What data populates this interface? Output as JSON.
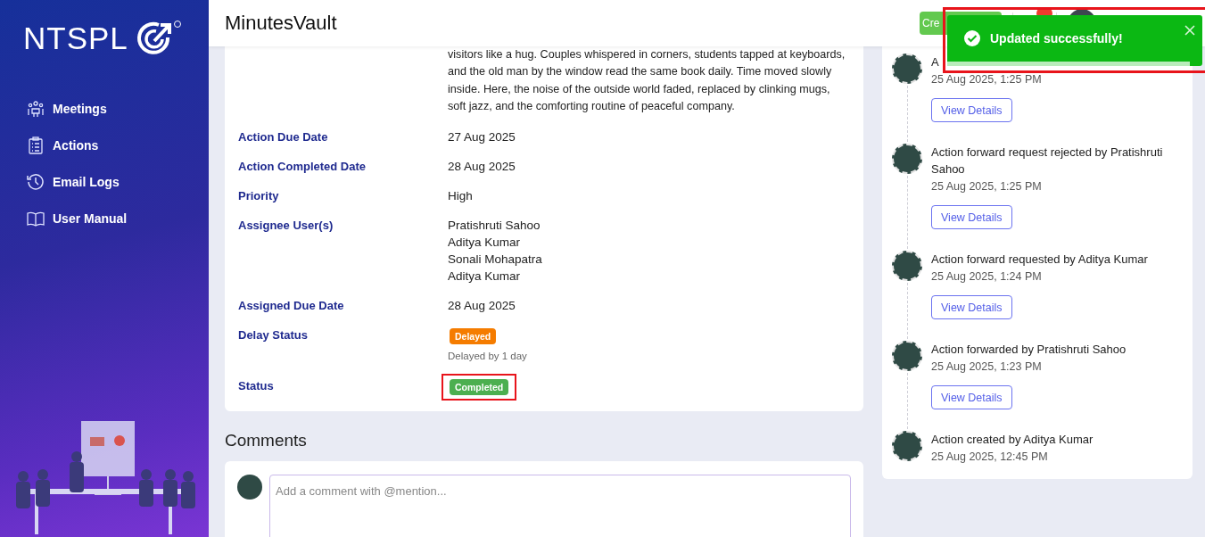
{
  "sidebar": {
    "logo": "NTSPL",
    "items": [
      {
        "label": "Meetings"
      },
      {
        "label": "Actions"
      },
      {
        "label": "Email Logs"
      },
      {
        "label": "User Manual"
      }
    ]
  },
  "header": {
    "title": "MinutesVault",
    "create_button": "Cre"
  },
  "details": {
    "description": "visitors like a hug. Couples whispered in corners, students tapped at keyboards,\nand the old man by the window read the same book daily. Time moved slowly\ninside. Here, the noise of the outside world faded, replaced by clinking mugs,\nsoft jazz, and the comforting routine of peaceful company.",
    "fields": [
      {
        "kind": "text",
        "label": "Action Due Date",
        "value": "27 Aug 2025"
      },
      {
        "kind": "text",
        "label": "Action Completed Date",
        "value": "28 Aug 2025"
      },
      {
        "kind": "text",
        "label": "Priority",
        "value": "High"
      },
      {
        "kind": "list",
        "label": "Assignee User(s)",
        "values": [
          "Pratishruti Sahoo",
          "Aditya Kumar",
          "Sonali Mohapatra",
          "Aditya Kumar"
        ]
      },
      {
        "kind": "text",
        "label": "Assigned Due Date",
        "value": "28 Aug 2025"
      },
      {
        "kind": "badge",
        "label": "Delay Status",
        "badge": "Delayed",
        "color": "#f57c00",
        "note": "Delayed by 1 day",
        "highlighted": false
      },
      {
        "kind": "badge",
        "label": "Status",
        "badge": "Completed",
        "color": "#4caf50",
        "highlighted": true
      }
    ]
  },
  "comments": {
    "title": "Comments",
    "placeholder": "Add a comment with @mention..."
  },
  "timeline": [
    {
      "title": "A",
      "time": "25 Aug 2025, 1:25 PM",
      "button": "View Details"
    },
    {
      "title": "Action forward request rejected by Pratishruti Sahoo",
      "time": "25 Aug 2025, 1:25 PM",
      "button": "View Details"
    },
    {
      "title": "Action forward requested by Aditya Kumar",
      "time": "25 Aug 2025, 1:24 PM",
      "button": "View Details"
    },
    {
      "title": "Action forwarded by Pratishruti Sahoo",
      "time": "25 Aug 2025, 1:23 PM",
      "button": "View Details"
    },
    {
      "title": "Action created by Aditya Kumar",
      "time": "25 Aug 2025, 12:45 PM"
    }
  ],
  "toast": {
    "message": "Updated successfully!",
    "level": 0.95,
    "highlighted": true
  }
}
